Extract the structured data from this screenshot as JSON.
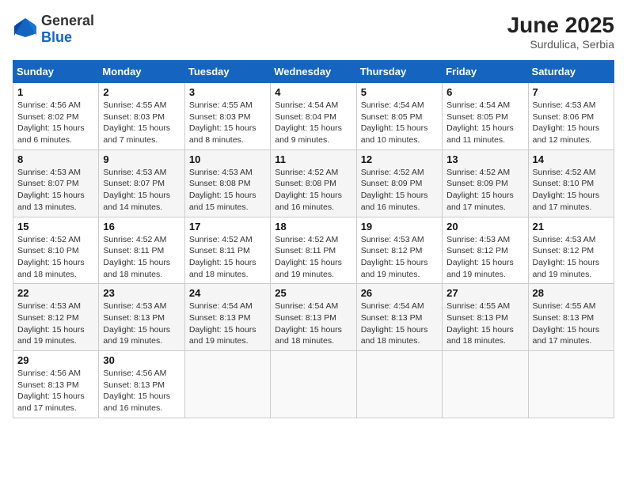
{
  "logo": {
    "general": "General",
    "blue": "Blue"
  },
  "title": "June 2025",
  "subtitle": "Surdulica, Serbia",
  "days_of_week": [
    "Sunday",
    "Monday",
    "Tuesday",
    "Wednesday",
    "Thursday",
    "Friday",
    "Saturday"
  ],
  "weeks": [
    [
      {
        "day": "1",
        "sunrise": "4:56 AM",
        "sunset": "8:02 PM",
        "daylight": "15 hours and 6 minutes."
      },
      {
        "day": "2",
        "sunrise": "4:55 AM",
        "sunset": "8:03 PM",
        "daylight": "15 hours and 7 minutes."
      },
      {
        "day": "3",
        "sunrise": "4:55 AM",
        "sunset": "8:03 PM",
        "daylight": "15 hours and 8 minutes."
      },
      {
        "day": "4",
        "sunrise": "4:54 AM",
        "sunset": "8:04 PM",
        "daylight": "15 hours and 9 minutes."
      },
      {
        "day": "5",
        "sunrise": "4:54 AM",
        "sunset": "8:05 PM",
        "daylight": "15 hours and 10 minutes."
      },
      {
        "day": "6",
        "sunrise": "4:54 AM",
        "sunset": "8:05 PM",
        "daylight": "15 hours and 11 minutes."
      },
      {
        "day": "7",
        "sunrise": "4:53 AM",
        "sunset": "8:06 PM",
        "daylight": "15 hours and 12 minutes."
      }
    ],
    [
      {
        "day": "8",
        "sunrise": "4:53 AM",
        "sunset": "8:07 PM",
        "daylight": "15 hours and 13 minutes."
      },
      {
        "day": "9",
        "sunrise": "4:53 AM",
        "sunset": "8:07 PM",
        "daylight": "15 hours and 14 minutes."
      },
      {
        "day": "10",
        "sunrise": "4:53 AM",
        "sunset": "8:08 PM",
        "daylight": "15 hours and 15 minutes."
      },
      {
        "day": "11",
        "sunrise": "4:52 AM",
        "sunset": "8:08 PM",
        "daylight": "15 hours and 16 minutes."
      },
      {
        "day": "12",
        "sunrise": "4:52 AM",
        "sunset": "8:09 PM",
        "daylight": "15 hours and 16 minutes."
      },
      {
        "day": "13",
        "sunrise": "4:52 AM",
        "sunset": "8:09 PM",
        "daylight": "15 hours and 17 minutes."
      },
      {
        "day": "14",
        "sunrise": "4:52 AM",
        "sunset": "8:10 PM",
        "daylight": "15 hours and 17 minutes."
      }
    ],
    [
      {
        "day": "15",
        "sunrise": "4:52 AM",
        "sunset": "8:10 PM",
        "daylight": "15 hours and 18 minutes."
      },
      {
        "day": "16",
        "sunrise": "4:52 AM",
        "sunset": "8:11 PM",
        "daylight": "15 hours and 18 minutes."
      },
      {
        "day": "17",
        "sunrise": "4:52 AM",
        "sunset": "8:11 PM",
        "daylight": "15 hours and 18 minutes."
      },
      {
        "day": "18",
        "sunrise": "4:52 AM",
        "sunset": "8:11 PM",
        "daylight": "15 hours and 19 minutes."
      },
      {
        "day": "19",
        "sunrise": "4:53 AM",
        "sunset": "8:12 PM",
        "daylight": "15 hours and 19 minutes."
      },
      {
        "day": "20",
        "sunrise": "4:53 AM",
        "sunset": "8:12 PM",
        "daylight": "15 hours and 19 minutes."
      },
      {
        "day": "21",
        "sunrise": "4:53 AM",
        "sunset": "8:12 PM",
        "daylight": "15 hours and 19 minutes."
      }
    ],
    [
      {
        "day": "22",
        "sunrise": "4:53 AM",
        "sunset": "8:12 PM",
        "daylight": "15 hours and 19 minutes."
      },
      {
        "day": "23",
        "sunrise": "4:53 AM",
        "sunset": "8:13 PM",
        "daylight": "15 hours and 19 minutes."
      },
      {
        "day": "24",
        "sunrise": "4:54 AM",
        "sunset": "8:13 PM",
        "daylight": "15 hours and 19 minutes."
      },
      {
        "day": "25",
        "sunrise": "4:54 AM",
        "sunset": "8:13 PM",
        "daylight": "15 hours and 18 minutes."
      },
      {
        "day": "26",
        "sunrise": "4:54 AM",
        "sunset": "8:13 PM",
        "daylight": "15 hours and 18 minutes."
      },
      {
        "day": "27",
        "sunrise": "4:55 AM",
        "sunset": "8:13 PM",
        "daylight": "15 hours and 18 minutes."
      },
      {
        "day": "28",
        "sunrise": "4:55 AM",
        "sunset": "8:13 PM",
        "daylight": "15 hours and 17 minutes."
      }
    ],
    [
      {
        "day": "29",
        "sunrise": "4:56 AM",
        "sunset": "8:13 PM",
        "daylight": "15 hours and 17 minutes."
      },
      {
        "day": "30",
        "sunrise": "4:56 AM",
        "sunset": "8:13 PM",
        "daylight": "15 hours and 16 minutes."
      },
      null,
      null,
      null,
      null,
      null
    ]
  ]
}
